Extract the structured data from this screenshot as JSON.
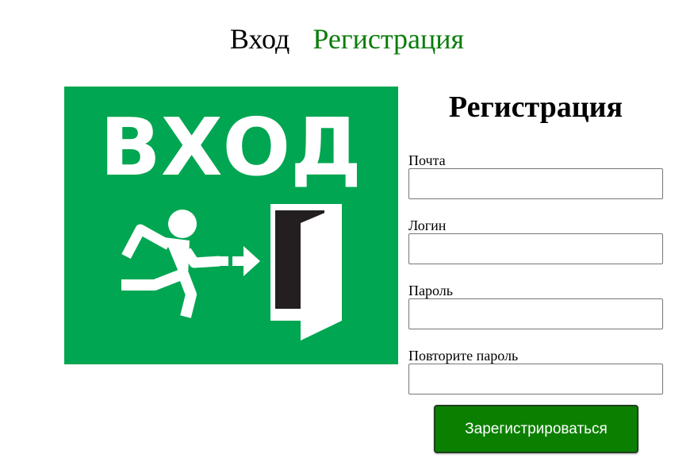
{
  "nav": {
    "login_link": "Вход",
    "register_link": "Регистрация"
  },
  "exit_sign": {
    "text": "ВХОД",
    "background_color": "#00a651",
    "icon": "running-man-exit-door-icon"
  },
  "form": {
    "title": "Регистрация",
    "fields": [
      {
        "label": "Почта",
        "value": "",
        "placeholder": ""
      },
      {
        "label": "Логин",
        "value": "",
        "placeholder": ""
      },
      {
        "label": "Пароль",
        "value": "",
        "placeholder": ""
      },
      {
        "label": "Повторите пароль",
        "value": "",
        "placeholder": ""
      }
    ],
    "submit_label": "Зарегистрироваться",
    "submit_color": "#0b8000"
  },
  "colors": {
    "register_link": "#0b7d0b",
    "login_link": "#000000"
  }
}
